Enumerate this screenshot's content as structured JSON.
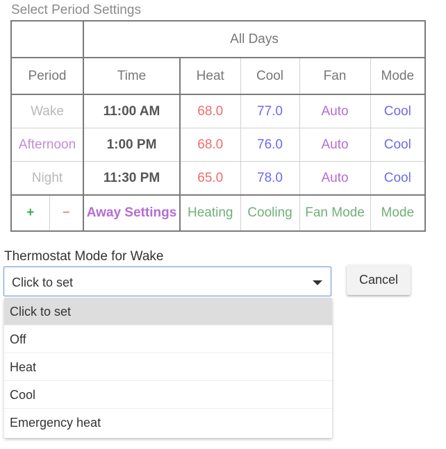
{
  "section_title": "Select Period Settings",
  "table": {
    "group_header": "All Days",
    "columns": {
      "period": "Period",
      "time": "Time",
      "heat": "Heat",
      "cool": "Cool",
      "fan": "Fan",
      "mode": "Mode"
    },
    "rows": [
      {
        "name": "Wake",
        "time": "11:00 AM",
        "heat": "68.0",
        "cool": "77.0",
        "fan": "Auto",
        "mode": "Cool"
      },
      {
        "name": "Afternoon",
        "time": "1:00 PM",
        "heat": "68.0",
        "cool": "76.0",
        "fan": "Auto",
        "mode": "Cool"
      },
      {
        "name": "Night",
        "time": "11:30 PM",
        "heat": "65.0",
        "cool": "78.0",
        "fan": "Auto",
        "mode": "Cool"
      }
    ],
    "actions": {
      "add": "+",
      "remove": "−",
      "away_settings": "Away Settings",
      "heating": "Heating",
      "cooling": "Cooling",
      "fan_mode": "Fan Mode",
      "mode": "Mode"
    }
  },
  "mode_selector": {
    "label": "Thermostat Mode for Wake",
    "selected": "Click to set",
    "options": [
      "Click to set",
      "Off",
      "Heat",
      "Cool",
      "Emergency heat"
    ],
    "cancel_label": "Cancel"
  },
  "colors": {
    "heat": "#f06c6c",
    "cool": "#6b6bef",
    "fan": "#b56cd4",
    "accent_green": "#6fb07a",
    "select_border": "#6a8fd6"
  }
}
